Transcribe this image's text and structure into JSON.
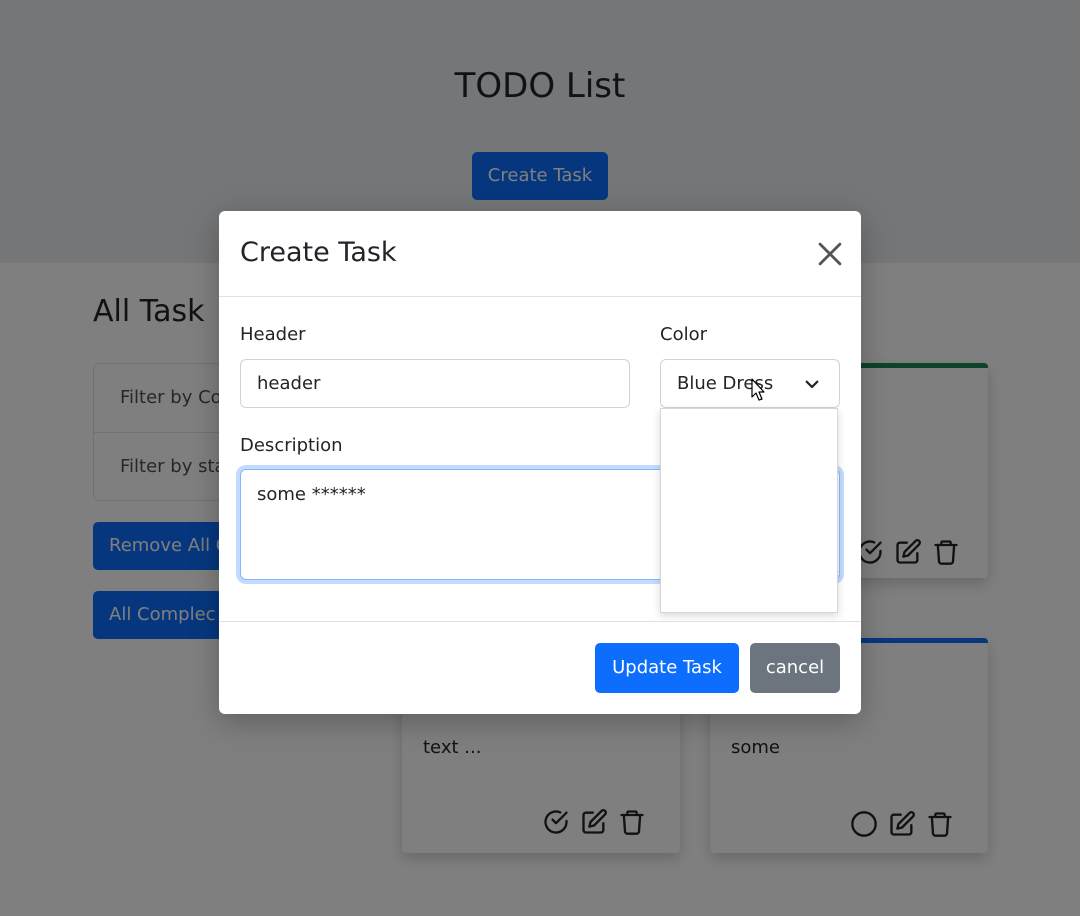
{
  "app": {
    "title": "TODO List",
    "create_task_label": "Create Task"
  },
  "sidebar": {
    "heading": "All Task",
    "filters": [
      "Filter by Co",
      "Filter by sta"
    ],
    "remove_all_label": "Remove All C",
    "all_complete_label": "All Complec"
  },
  "cards": [
    {
      "text": "text ...",
      "accent": null,
      "status_icon": "check-circle-icon"
    },
    {
      "text": "some",
      "accent": "#0d6efd",
      "status_icon": "circle-icon"
    },
    {
      "text": "",
      "accent": "#198754",
      "status_icon": "check-circle-icon"
    }
  ],
  "modal": {
    "title": "Create Task",
    "header_label": "Header",
    "header_value": "header",
    "color_label": "Color",
    "color_value": "Blue Dress",
    "description_label": "Description",
    "description_value": "some ******",
    "update_label": "Update Task",
    "cancel_label": "cancel"
  },
  "colors": {
    "primary": "#0d6efd",
    "secondary": "#6c757d",
    "success": "#198754"
  }
}
